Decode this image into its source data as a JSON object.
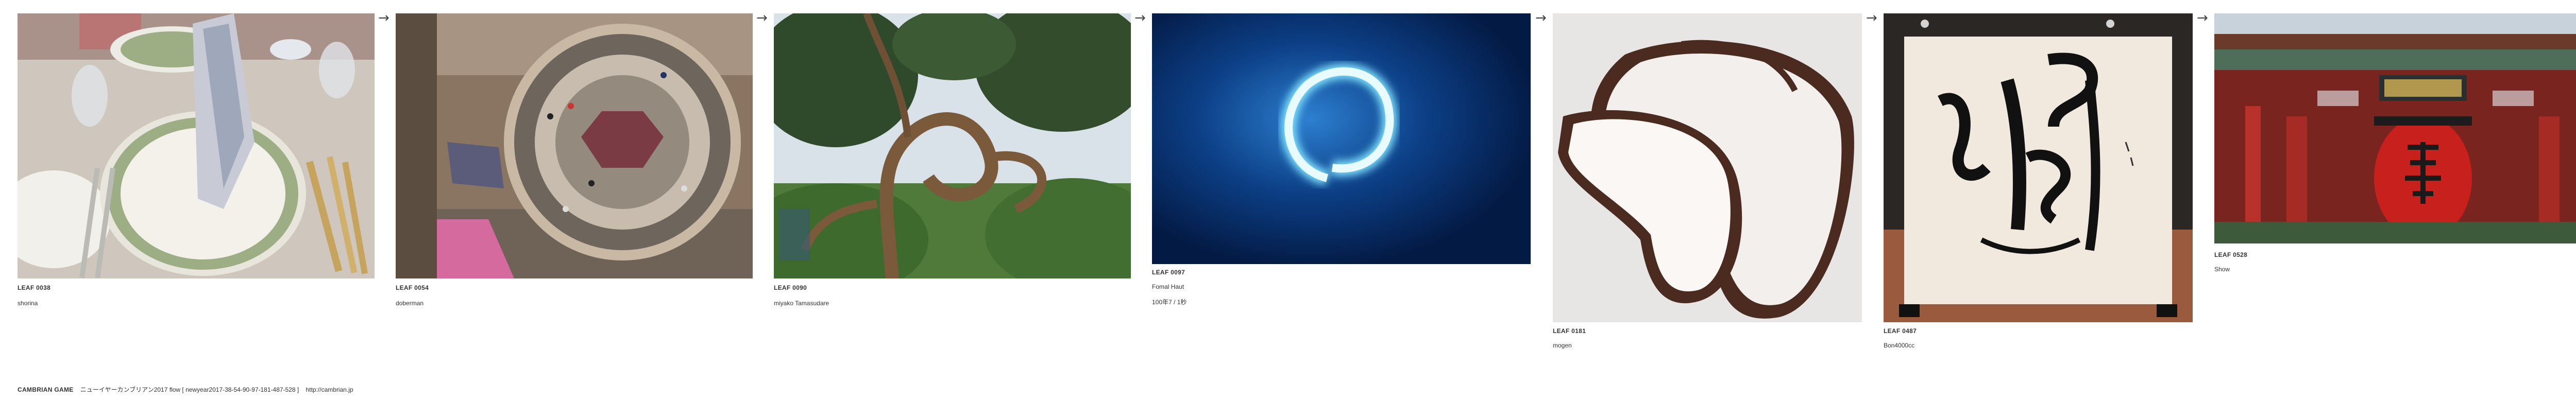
{
  "leaves": [
    {
      "id": "LEAF 0038",
      "author": "shorina",
      "icon": "table-setting-photo"
    },
    {
      "id": "LEAF 0054",
      "author": "doberman",
      "icon": "spiral-building-photo"
    },
    {
      "id": "LEAF 0090",
      "author": "miyako Tamasudare",
      "icon": "pine-tree-photo"
    },
    {
      "id": "LEAF 0097",
      "author": "Fomal Haut",
      "extra": "100年7 / 1秒",
      "icon": "neon-ring-photo"
    },
    {
      "id": "LEAF 0181",
      "author": "mogen",
      "icon": "mochi-slices-photo"
    },
    {
      "id": "LEAF 0487",
      "author": "Bon4000cc",
      "icon": "calligraphy-photo"
    },
    {
      "id": "LEAF 0528",
      "author": "Show",
      "icon": "kaminarimon-gate-photo"
    }
  ],
  "arrow_glyph": "→",
  "footer": {
    "game": "CAMBRIAN GAME",
    "title": "ニューイヤーカンブリアン2017 flow [ newyear2017-38-54-90-97-181-487-528 ]",
    "url": "http://cambrian.jp"
  },
  "colors": {
    "text": "#333333",
    "arrow": "#444444",
    "background": "#ffffff"
  }
}
